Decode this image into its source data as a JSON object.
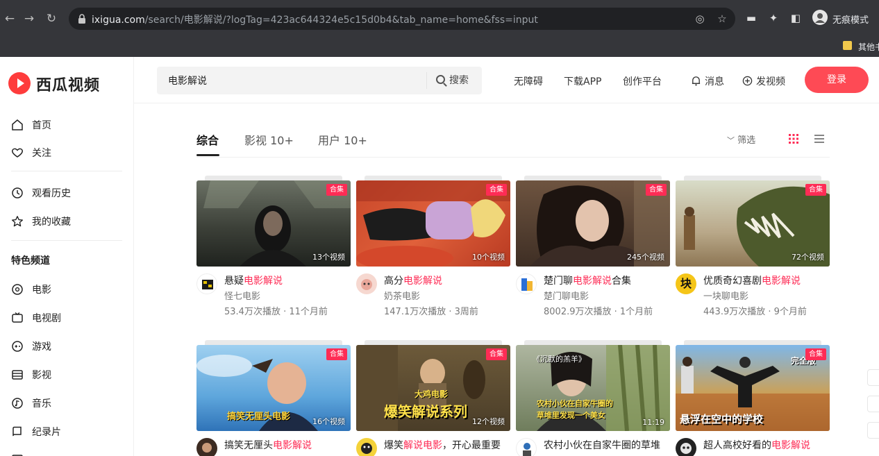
{
  "browser": {
    "url_domain": "ixigua.com",
    "url_rest": "/search/电影解说/?logTag=423ac644324e5c15d0b4&tab_name=home&fss=input",
    "incognito_label": "无痕模式",
    "bookmark_label": "其他书"
  },
  "site": {
    "logo_text": "西瓜视频",
    "search": {
      "value": "电影解说",
      "button_label": "搜索"
    },
    "header_links": [
      "无障碍",
      "下载APP",
      "创作平台"
    ],
    "messages_label": "消息",
    "upload_label": "发视频",
    "login_label": "登录",
    "accent_color": "#fe2c55"
  },
  "sidebar": {
    "group1": [
      {
        "label": "首页",
        "icon": "home-icon"
      },
      {
        "label": "关注",
        "icon": "heart-icon"
      }
    ],
    "group2": [
      {
        "label": "观看历史",
        "icon": "clock-icon"
      },
      {
        "label": "我的收藏",
        "icon": "star-icon"
      }
    ],
    "section_title": "特色频道",
    "channels": [
      {
        "label": "电影",
        "icon": "film-icon"
      },
      {
        "label": "电视剧",
        "icon": "tv-icon"
      },
      {
        "label": "游戏",
        "icon": "gamepad-icon"
      },
      {
        "label": "影视",
        "icon": "movie-screen-icon"
      },
      {
        "label": "音乐",
        "icon": "music-icon"
      },
      {
        "label": "纪录片",
        "icon": "documentary-icon"
      }
    ]
  },
  "tabs": [
    {
      "label": "综合",
      "active": true
    },
    {
      "label": "影视 10+",
      "active": false
    },
    {
      "label": "用户 10+",
      "active": false
    }
  ],
  "filter_label": "筛选",
  "cards": [
    {
      "tag": "合集",
      "count": "13个视频",
      "title_pre": "悬疑",
      "title_hl": "电影解说",
      "title_post": "",
      "author": "怪七电影",
      "stats": "53.4万次播放 · 11个月前"
    },
    {
      "tag": "合集",
      "count": "10个视频",
      "title_pre": "高分",
      "title_hl": "电影解说",
      "title_post": "",
      "author": "奶茶电影",
      "stats": "147.1万次播放 · 3周前"
    },
    {
      "tag": "合集",
      "count": "245个视频",
      "title_pre": "楚门聊",
      "title_hl": "电影解说",
      "title_post": "合集",
      "author": "楚门聊电影",
      "stats": "8002.9万次播放 · 1个月前"
    },
    {
      "tag": "合集",
      "count": "72个视频",
      "title_pre": "优质奇幻喜剧",
      "title_hl": "电影解说",
      "title_post": "",
      "author": "一块聊电影",
      "stats": "443.9万次播放 · 9个月前",
      "avatar_char": "块"
    },
    {
      "tag": "合集",
      "count": "16个视频",
      "overlay": "搞笑无厘头电影",
      "title_pre": "搞笑无厘头",
      "title_hl": "电影解说",
      "title_post": ""
    },
    {
      "tag": "合集",
      "count": "12个视频",
      "overlay_top": "大鸡电影",
      "overlay": "爆笑解说系列",
      "title_pre": "爆笑",
      "title_hl": "解说电影",
      "title_post": "，开心最重要"
    },
    {
      "tag": "",
      "count": "11:19",
      "overlay_top": "《沉默的羔羊》",
      "overlay": "农村小伙在自家牛圈的",
      "overlay2": "草堆里发现一个美女",
      "title_pre": "农村小伙在自家牛圈的草堆",
      "title_hl": "",
      "title_post": ""
    },
    {
      "tag": "合集",
      "count": "",
      "overlay": "悬浮在空中的学校",
      "overlay_top": "完全版",
      "title_pre": "超人高校好看的",
      "title_hl": "电影解说",
      "title_post": ""
    }
  ]
}
